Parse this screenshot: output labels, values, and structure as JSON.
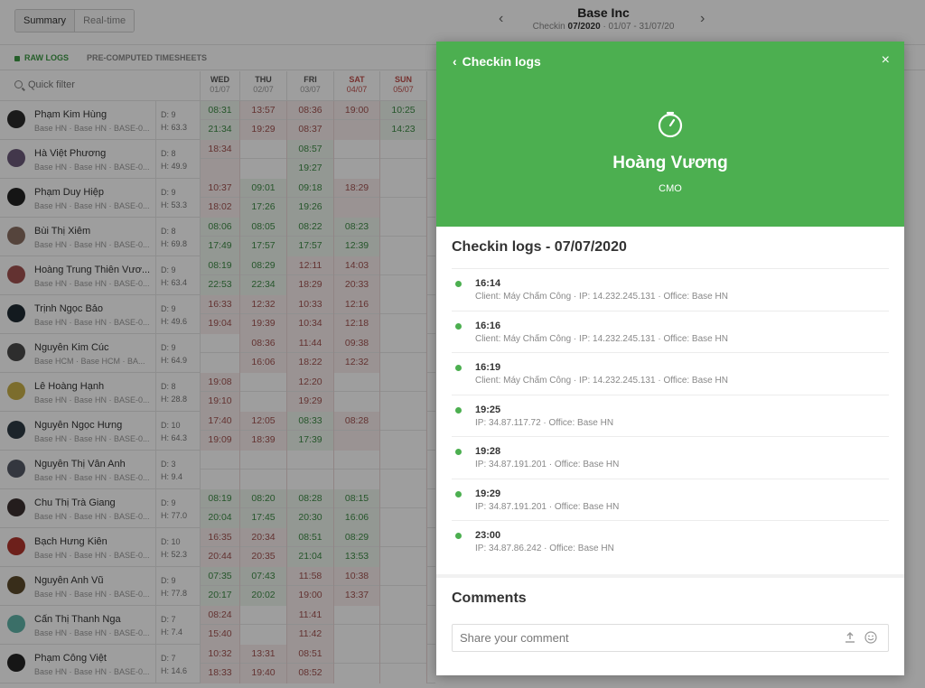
{
  "header": {
    "tabs": [
      "Summary",
      "Real-time"
    ],
    "company": "Base Inc",
    "range_prefix": "Checkin",
    "range_bold": "07/2020",
    "range_suffix": "· 01/07 - 31/07/20"
  },
  "subtabs": [
    "RAW LOGS",
    "PRE-COMPUTED TIMESHEETS"
  ],
  "filter": {
    "label": "Quick filter"
  },
  "days": [
    {
      "name": "WED",
      "date": "01/07",
      "weekend": false
    },
    {
      "name": "THU",
      "date": "02/07",
      "weekend": false
    },
    {
      "name": "FRI",
      "date": "03/07",
      "weekend": false
    },
    {
      "name": "SAT",
      "date": "04/07",
      "weekend": true
    },
    {
      "name": "SUN",
      "date": "05/07",
      "weekend": true
    }
  ],
  "people": [
    {
      "name": "Phạm Kim Hùng",
      "meta": "Base HN · Base HN · BASE-0...",
      "d": "D: 9",
      "h": "H: 63.3",
      "avatar": "#2b2b2b",
      "cells": [
        [
          "08:31",
          "21:34",
          "ok"
        ],
        [
          "13:57",
          "19:29",
          "late"
        ],
        [
          "08:36",
          "08:37",
          "late"
        ],
        [
          "19:00",
          "",
          "late"
        ],
        [
          "10:25",
          "14:23",
          "ok"
        ]
      ]
    },
    {
      "name": "Hà Việt Phương",
      "meta": "Base HN · Base HN · BASE-0...",
      "d": "D: 8",
      "h": "H: 49.9",
      "avatar": "#6b5a7a",
      "cells": [
        [
          "18:34",
          "",
          "late"
        ],
        [
          "",
          "",
          "none"
        ],
        [
          "08:57",
          "19:27",
          "ok"
        ],
        [
          "",
          "",
          "none"
        ],
        [
          "",
          "",
          "none"
        ]
      ]
    },
    {
      "name": "Phạm Duy Hiệp",
      "meta": "Base HN · Base HN · BASE-0...",
      "d": "D: 9",
      "h": "H: 53.3",
      "avatar": "#222222",
      "cells": [
        [
          "10:37",
          "18:02",
          "late"
        ],
        [
          "09:01",
          "17:26",
          "ok"
        ],
        [
          "09:18",
          "19:26",
          "ok"
        ],
        [
          "18:29",
          "",
          "late"
        ],
        [
          "",
          "",
          "none"
        ]
      ]
    },
    {
      "name": "Bùi Thị Xiêm",
      "meta": "Base HN · Base HN · BASE-0...",
      "d": "D: 8",
      "h": "H: 69.8",
      "avatar": "#8a6f62",
      "cells": [
        [
          "08:06",
          "17:49",
          "ok"
        ],
        [
          "08:05",
          "17:57",
          "ok"
        ],
        [
          "08:22",
          "17:57",
          "ok"
        ],
        [
          "08:23",
          "12:39",
          "ok"
        ],
        [
          "",
          "",
          "none"
        ]
      ]
    },
    {
      "name": "Hoàng Trung Thiên Vươ...",
      "meta": "Base HN · Base HN · BASE-0...",
      "d": "D: 9",
      "h": "H: 63.4",
      "avatar": "#a0524f",
      "cells": [
        [
          "08:19",
          "22:53",
          "ok"
        ],
        [
          "08:29",
          "22:34",
          "ok"
        ],
        [
          "12:11",
          "18:29",
          "late"
        ],
        [
          "14:03",
          "20:33",
          "late"
        ],
        [
          "",
          "",
          "none"
        ]
      ]
    },
    {
      "name": "Trịnh Ngọc Bảo",
      "meta": "Base HN · Base HN · BASE-0...",
      "d": "D: 9",
      "h": "H: 49.6",
      "avatar": "#1f2a33",
      "cells": [
        [
          "16:33",
          "19:04",
          "late"
        ],
        [
          "12:32",
          "19:39",
          "late"
        ],
        [
          "10:33",
          "10:34",
          "late"
        ],
        [
          "12:16",
          "12:18",
          "late"
        ],
        [
          "",
          "",
          "none"
        ]
      ]
    },
    {
      "name": "Nguyễn Kim Cúc",
      "meta": "Base HCM · Base HCM · BA...",
      "d": "D: 9",
      "h": "H: 64.9",
      "avatar": "#4a4a4a",
      "cells": [
        [
          "",
          "",
          "none"
        ],
        [
          "08:36",
          "16:06",
          "late"
        ],
        [
          "11:44",
          "18:22",
          "late"
        ],
        [
          "09:38",
          "12:32",
          "late"
        ],
        [
          "",
          "",
          "none"
        ]
      ]
    },
    {
      "name": "Lê Hoàng Hạnh",
      "meta": "Base HN · Base HN · BASE-0...",
      "d": "D: 8",
      "h": "H: 28.8",
      "avatar": "#c9b04a",
      "cells": [
        [
          "19:08",
          "19:10",
          "late"
        ],
        [
          "",
          "",
          "none"
        ],
        [
          "12:20",
          "19:29",
          "late"
        ],
        [
          "",
          "",
          "none"
        ],
        [
          "",
          "",
          "none"
        ]
      ]
    },
    {
      "name": "Nguyễn Ngọc Hưng",
      "meta": "Base HN · Base HN · BASE-0...",
      "d": "D: 10",
      "h": "H: 64.3",
      "avatar": "#2e3b44",
      "cells": [
        [
          "17:40",
          "19:09",
          "late"
        ],
        [
          "12:05",
          "18:39",
          "late"
        ],
        [
          "08:33",
          "17:39",
          "ok"
        ],
        [
          "08:28",
          "",
          "late"
        ],
        [
          "",
          "",
          "none"
        ]
      ]
    },
    {
      "name": "Nguyễn Thị Vân Anh",
      "meta": "Base HN · Base HN · BASE-0...",
      "d": "D: 3",
      "h": "H: 9.4",
      "avatar": "#555a66",
      "cells": [
        [
          "",
          "",
          "none"
        ],
        [
          "",
          "",
          "none"
        ],
        [
          "",
          "",
          "none"
        ],
        [
          "",
          "",
          "none"
        ],
        [
          "",
          "",
          "none"
        ]
      ]
    },
    {
      "name": "Chu Thị Trà Giang",
      "meta": "Base HN · Base HN · BASE-0...",
      "d": "D: 9",
      "h": "H: 77.0",
      "avatar": "#3a3030",
      "cells": [
        [
          "08:19",
          "20:04",
          "ok"
        ],
        [
          "08:20",
          "17:45",
          "ok"
        ],
        [
          "08:28",
          "20:30",
          "ok"
        ],
        [
          "08:15",
          "16:06",
          "ok"
        ],
        [
          "",
          "",
          "none"
        ]
      ]
    },
    {
      "name": "Bạch Hưng Kiên",
      "meta": "Base HN · Base HN · BASE-0...",
      "d": "D: 10",
      "h": "H: 52.3",
      "avatar": "#b0342c",
      "cells": [
        [
          "16:35",
          "20:44",
          "late"
        ],
        [
          "20:34",
          "20:35",
          "late"
        ],
        [
          "08:51",
          "21:04",
          "ok"
        ],
        [
          "08:29",
          "13:53",
          "ok"
        ],
        [
          "",
          "",
          "none"
        ]
      ]
    },
    {
      "name": "Nguyễn Anh Vũ",
      "meta": "Base HN · Base HN · BASE-0...",
      "d": "D: 9",
      "h": "H: 77.8",
      "avatar": "#5b4a2a",
      "cells": [
        [
          "07:35",
          "20:17",
          "ok"
        ],
        [
          "07:43",
          "20:02",
          "ok"
        ],
        [
          "11:58",
          "19:00",
          "late"
        ],
        [
          "10:38",
          "13:37",
          "late"
        ],
        [
          "",
          "",
          "none"
        ]
      ]
    },
    {
      "name": "Cấn Thị Thanh Nga",
      "meta": "Base HN · Base HN · BASE-0...",
      "d": "D: 7",
      "h": "H: 7.4",
      "avatar": "#5fb4a8",
      "cells": [
        [
          "08:24",
          "15:40",
          "late"
        ],
        [
          "",
          "",
          "none"
        ],
        [
          "11:41",
          "11:42",
          "late"
        ],
        [
          "",
          "",
          "none"
        ],
        [
          "",
          "",
          "none"
        ]
      ]
    },
    {
      "name": "Phạm Công Việt",
      "meta": "Base HN · Base HN · BASE-0...",
      "d": "D: 7",
      "h": "H: 14.6",
      "avatar": "#252525",
      "cells": [
        [
          "10:32",
          "18:33",
          "late"
        ],
        [
          "13:31",
          "19:40",
          "late"
        ],
        [
          "08:51",
          "08:52",
          "late"
        ],
        [
          "",
          "",
          "none"
        ],
        [
          "",
          "",
          "none"
        ]
      ]
    }
  ],
  "panel": {
    "back_label": "Checkin logs",
    "close_label": "×",
    "person_name": "Hoàng Vương",
    "person_role": "CMO",
    "logs_title": "Checkin logs - 07/07/2020",
    "logs": [
      {
        "time": "16:14",
        "meta": "Client: Máy Chấm Công · IP: 14.232.245.131 · Office: Base HN"
      },
      {
        "time": "16:16",
        "meta": "Client: Máy Chấm Công · IP: 14.232.245.131 · Office: Base HN"
      },
      {
        "time": "16:19",
        "meta": "Client: Máy Chấm Công · IP: 14.232.245.131 · Office: Base HN"
      },
      {
        "time": "19:25",
        "meta": "IP: 34.87.117.72 · Office: Base HN"
      },
      {
        "time": "19:28",
        "meta": "IP: 34.87.191.201 · Office: Base HN"
      },
      {
        "time": "19:29",
        "meta": "IP: 34.87.191.201 · Office: Base HN"
      },
      {
        "time": "23:00",
        "meta": "IP: 34.87.86.242 · Office: Base HN"
      }
    ],
    "comments_title": "Comments",
    "comment_placeholder": "Share your comment"
  },
  "colors": {
    "accent": "#4caf50",
    "late_bg": "#f9eeee",
    "ok_bg": "#eef6ee"
  },
  "icons": {
    "back": "chevron-left-icon",
    "close": "close-icon",
    "timer": "timer-icon",
    "upload": "upload-icon",
    "emoji": "smile-icon"
  }
}
